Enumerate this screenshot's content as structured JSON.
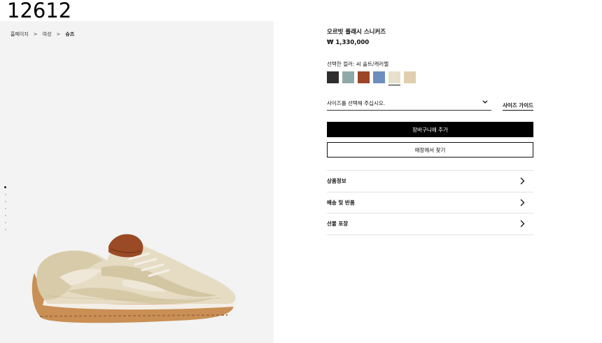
{
  "item_code": "12612",
  "breadcrumb": {
    "items": [
      "홈페이지",
      "여성",
      "슈즈"
    ],
    "separator": ">"
  },
  "gallery": {
    "dot_count": 7,
    "active_dot": 1
  },
  "product": {
    "name": "오르빗 플래시 스니커즈",
    "price": "₩ 1,330,000"
  },
  "colors": {
    "label": "선택한 컬러: 씨 솔트/캐러멜",
    "swatches": [
      {
        "name": "black",
        "color": "#2e2e2e",
        "selected": false
      },
      {
        "name": "sage-blue",
        "color": "#8fa9aa",
        "selected": false
      },
      {
        "name": "rust",
        "color": "#9c4628",
        "selected": false
      },
      {
        "name": "denim-blue",
        "color": "#6c8fbd",
        "selected": false
      },
      {
        "name": "sea-salt-caramel",
        "color": "#e7e0cc",
        "selected": true
      },
      {
        "name": "sand",
        "color": "#dfcfae",
        "selected": false
      }
    ]
  },
  "size": {
    "placeholder": "사이즈를 선택해 주십시오.",
    "guide_label": "사이즈 가이드"
  },
  "actions": {
    "add_to_cart": "장바구니에 추가",
    "find_in_store": "매장에서 찾기"
  },
  "accordion": {
    "items": [
      "상품정보",
      "배송 및 반품",
      "선물 포장"
    ]
  },
  "theme": {
    "gallery_bg": "#f2f3f2",
    "primary_button": "#000000"
  }
}
